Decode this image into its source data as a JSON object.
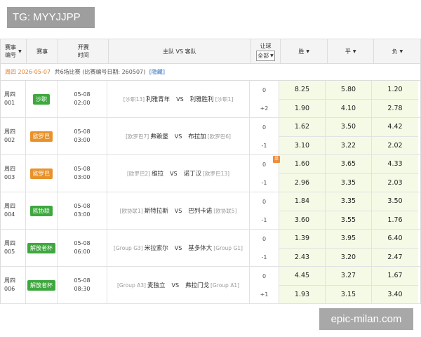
{
  "watermarks": {
    "top_left": "TG: MYYJJPP",
    "bottom_right": "epic-milan.com"
  },
  "header": {
    "id_label_1": "赛事",
    "id_label_2": "编号",
    "league_label": "赛事",
    "time_label_1": "开赛",
    "time_label_2": "时间",
    "match_label": "主队 VS 客队",
    "handicap_label": "让球",
    "handicap_filter": "全部",
    "win_label": "胜",
    "draw_label": "平",
    "lose_label": "负"
  },
  "subheader": {
    "date": "周四 2026-05-07",
    "info": "共6场比赛 (比赛编号日期: 260507)",
    "hide_link": "[隐藏]"
  },
  "colors": {
    "league_green": "#3ea83e",
    "league_orange": "#e8922b",
    "odds_bg": "#f5fae6",
    "date_orange": "#e0802e"
  },
  "matches": [
    {
      "day": "周四",
      "num": "001",
      "league": "沙职",
      "league_color": "#3ea83e",
      "date": "05-08",
      "time": "02:00",
      "home_tag": "[沙职13]",
      "home": "利雅青年",
      "vs": "VS",
      "away": "利雅胜利",
      "away_tag": "[沙职1]",
      "handicap": [
        "0",
        "+2"
      ],
      "flag": "",
      "odds": [
        [
          "8.25",
          "5.80",
          "1.20"
        ],
        [
          "1.90",
          "4.10",
          "2.78"
        ]
      ]
    },
    {
      "day": "周四",
      "num": "002",
      "league": "欧罗巴",
      "league_color": "#e8922b",
      "date": "05-08",
      "time": "03:00",
      "home_tag": "[欧罗巴7]",
      "home": "弗赖堡",
      "vs": "VS",
      "away": "布拉加",
      "away_tag": "[欧罗巴6]",
      "handicap": [
        "0",
        "-1"
      ],
      "flag": "",
      "odds": [
        [
          "1.62",
          "3.50",
          "4.42"
        ],
        [
          "3.10",
          "3.22",
          "2.02"
        ]
      ]
    },
    {
      "day": "周四",
      "num": "003",
      "league": "欧罗巴",
      "league_color": "#e8922b",
      "date": "05-08",
      "time": "03:00",
      "home_tag": "[欧罗巴2]",
      "home": "维拉",
      "vs": "VS",
      "away": "诺丁汉",
      "away_tag": "[欧罗巴13]",
      "handicap": [
        "0",
        "-1"
      ],
      "flag": "单",
      "odds": [
        [
          "1.60",
          "3.65",
          "4.33"
        ],
        [
          "2.96",
          "3.35",
          "2.03"
        ]
      ]
    },
    {
      "day": "周四",
      "num": "004",
      "league": "欧协联",
      "league_color": "#3ea83e",
      "date": "05-08",
      "time": "03:00",
      "home_tag": "[欧协联1]",
      "home": "斯特拉斯",
      "vs": "VS",
      "away": "巴列卡诺",
      "away_tag": "[欧协联5]",
      "handicap": [
        "0",
        "-1"
      ],
      "flag": "",
      "odds": [
        [
          "1.84",
          "3.35",
          "3.50"
        ],
        [
          "3.60",
          "3.55",
          "1.76"
        ]
      ]
    },
    {
      "day": "周四",
      "num": "005",
      "league": "解放者杯",
      "league_color": "#3ea83e",
      "date": "05-08",
      "time": "06:00",
      "home_tag": "[Group G3]",
      "home": "米拉索尔",
      "vs": "VS",
      "away": "基多体大",
      "away_tag": "[Group G1]",
      "handicap": [
        "0",
        "-1"
      ],
      "flag": "",
      "odds": [
        [
          "1.39",
          "3.95",
          "6.40"
        ],
        [
          "2.43",
          "3.20",
          "2.47"
        ]
      ]
    },
    {
      "day": "周四",
      "num": "006",
      "league": "解放者杯",
      "league_color": "#3ea83e",
      "date": "05-08",
      "time": "08:30",
      "home_tag": "[Group A3]",
      "home": "麦独立",
      "vs": "VS",
      "away": "弗拉门戈",
      "away_tag": "[Group A1]",
      "handicap": [
        "0",
        "+1"
      ],
      "flag": "",
      "odds": [
        [
          "4.45",
          "3.27",
          "1.67"
        ],
        [
          "1.93",
          "3.15",
          "3.40"
        ]
      ]
    }
  ]
}
